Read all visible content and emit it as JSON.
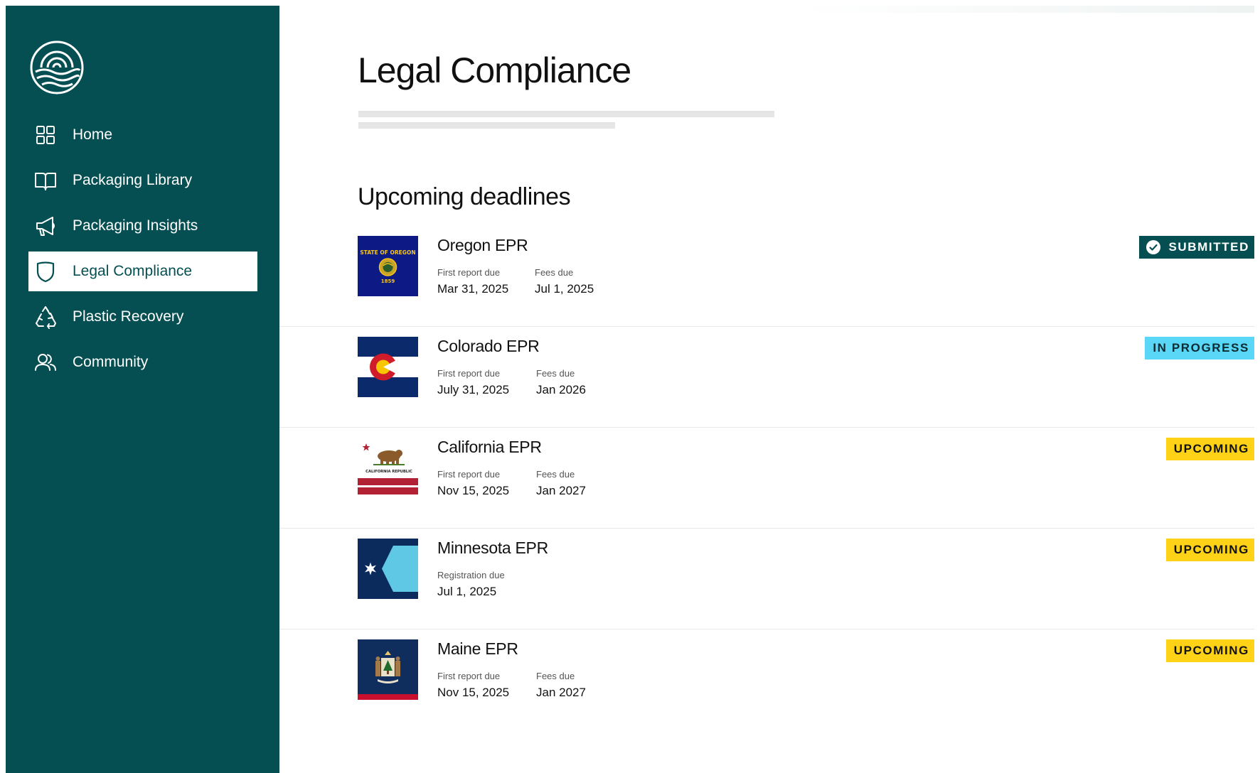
{
  "sidebar": {
    "items": [
      {
        "label": "Home",
        "icon": "grid-icon",
        "active": false
      },
      {
        "label": "Packaging Library",
        "icon": "book-icon",
        "active": false
      },
      {
        "label": "Packaging Insights",
        "icon": "megaphone-icon",
        "active": false
      },
      {
        "label": "Legal Compliance",
        "icon": "shield-icon",
        "active": true
      },
      {
        "label": "Plastic Recovery",
        "icon": "recycle-icon",
        "active": false
      },
      {
        "label": "Community",
        "icon": "users-icon",
        "active": false
      }
    ]
  },
  "main": {
    "title": "Legal Compliance",
    "section_title": "Upcoming deadlines"
  },
  "deadlines": [
    {
      "title": "Oregon EPR",
      "flag": "oregon-flag-icon",
      "flag_text": {
        "top": "STATE OF OREGON",
        "year": "1859"
      },
      "fields": [
        {
          "label": "First report due",
          "value": "Mar 31, 2025"
        },
        {
          "label": "Fees due",
          "value": "Jul 1, 2025"
        }
      ],
      "status": "SUBMITTED"
    },
    {
      "title": "Colorado EPR",
      "flag": "colorado-flag-icon",
      "fields": [
        {
          "label": "First report due",
          "value": "July 31, 2025"
        },
        {
          "label": "Fees due",
          "value": "Jan 2026"
        }
      ],
      "status": "IN PROGRESS"
    },
    {
      "title": "California EPR",
      "flag": "california-flag-icon",
      "flag_text": {
        "banner": "CALIFORNIA REPUBLIC"
      },
      "fields": [
        {
          "label": "First report due",
          "value": "Nov 15, 2025"
        },
        {
          "label": "Fees due",
          "value": "Jan 2027"
        }
      ],
      "status": "UPCOMING"
    },
    {
      "title": "Minnesota EPR",
      "flag": "minnesota-flag-icon",
      "fields": [
        {
          "label": "Registration due",
          "value": "Jul 1, 2025"
        }
      ],
      "status": "UPCOMING"
    },
    {
      "title": "Maine EPR",
      "flag": "maine-flag-icon",
      "fields": [
        {
          "label": "First report due",
          "value": "Nov 15, 2025"
        },
        {
          "label": "Fees due",
          "value": "Jan 2027"
        }
      ],
      "status": "UPCOMING"
    }
  ],
  "colors": {
    "sidebar_bg": "#054f52",
    "submitted_bg": "#054f52",
    "in_progress_bg": "#5ad6f6",
    "upcoming_bg": "#fed216"
  }
}
